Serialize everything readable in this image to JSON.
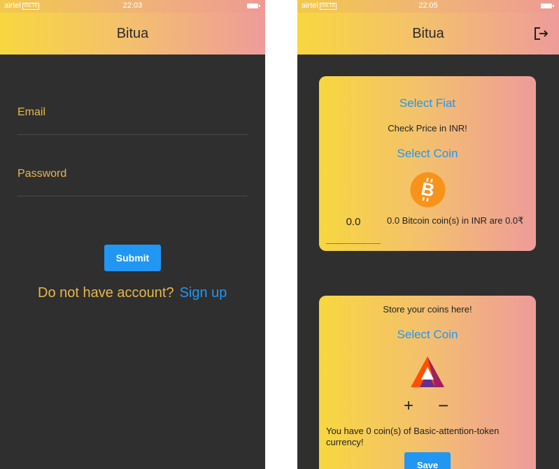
{
  "status_left": {
    "carrier": "airtel",
    "network_badge": "VoLTE",
    "time": "22:03"
  },
  "status_right": {
    "carrier": "airtel",
    "network_badge": "VoLTE",
    "time": "22:05"
  },
  "app": {
    "title": "Bitua"
  },
  "login": {
    "email_label": "Email",
    "password_label": "Password",
    "submit_label": "Submit",
    "no_account_text": "Do not have account?",
    "signup_link": "Sign up"
  },
  "fiat_card": {
    "select_fiat": "Select Fiat",
    "check_price": "Check Price in INR!",
    "select_coin": "Select Coin",
    "coin_icon": "bitcoin-icon",
    "amount_value": "0.0",
    "result_text": "0.0 Bitcoin coin(s) in INR are 0.0₹"
  },
  "store_card": {
    "heading": "Store your coins here!",
    "select_coin": "Select Coin",
    "coin_icon": "basic-attention-token-icon",
    "plus_label": "+",
    "minus_label": "−",
    "balance_text": "You have 0 coin(s) of Basic-attention-token currency!",
    "save_label": "Save"
  },
  "colors": {
    "accent": "#2196f3",
    "label_gold": "#e8b84a",
    "background": "#2f2f2f",
    "gradient_start": "#f7d73f",
    "gradient_end": "#ee9b9a"
  }
}
